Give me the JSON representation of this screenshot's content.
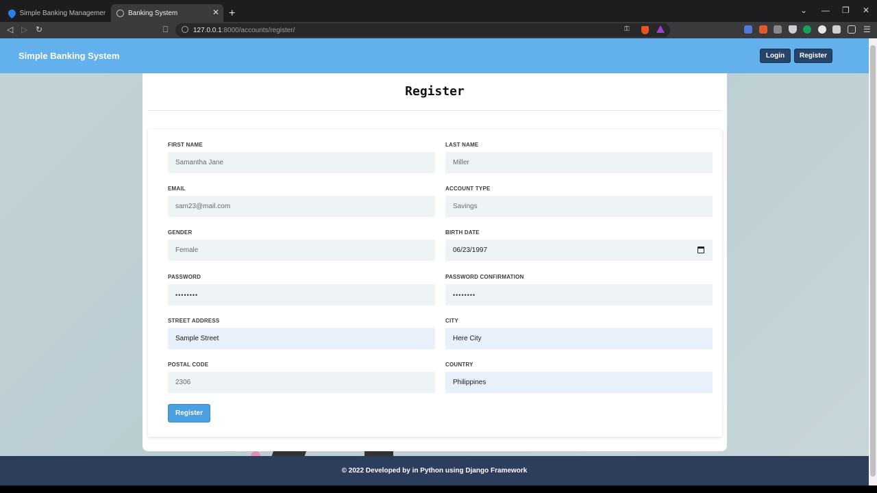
{
  "browser": {
    "tabs": [
      {
        "label": "Simple Banking Management System"
      },
      {
        "label": "Banking System"
      }
    ],
    "url_host": "127.0.0.1",
    "url_path": ":8000/accounts/register/"
  },
  "header": {
    "brand": "Simple Banking System",
    "login_label": "Login",
    "register_label": "Register"
  },
  "form": {
    "title": "Register",
    "first_name": {
      "label": "FIRST NAME",
      "value": "Samantha Jane"
    },
    "last_name": {
      "label": "LAST NAME",
      "value": "Miller"
    },
    "email": {
      "label": "EMAIL",
      "value": "sam23@mail.com"
    },
    "account_type": {
      "label": "ACCOUNT TYPE",
      "value": "Savings"
    },
    "gender": {
      "label": "GENDER",
      "value": "Female"
    },
    "birth_date": {
      "label": "BIRTH DATE",
      "value": "06/23/1997"
    },
    "password": {
      "label": "PASSWORD",
      "value": "••••••••"
    },
    "password_confirmation": {
      "label": "PASSWORD CONFIRMATION",
      "value": "••••••••"
    },
    "street_address": {
      "label": "STREET ADDRESS",
      "value": "Sample Street"
    },
    "city": {
      "label": "CITY",
      "value": "Here City"
    },
    "postal_code": {
      "label": "POSTAL CODE",
      "value": "2306"
    },
    "country": {
      "label": "COUNTRY",
      "value": "Philippines"
    },
    "submit_label": "Register"
  },
  "footer": {
    "text": "© 2022 Developed by in Python using Django Framework"
  }
}
